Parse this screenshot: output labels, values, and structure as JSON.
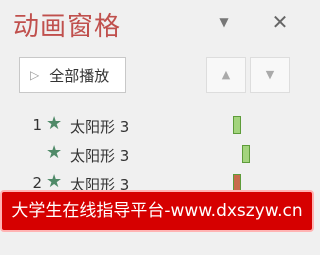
{
  "pane": {
    "title": "动画窗格",
    "menu_icon": "chevron-down-icon",
    "close_icon": "close-icon"
  },
  "toolbar": {
    "play_all_label": "全部播放",
    "move_up_icon": "triangle-up-icon",
    "move_down_icon": "triangle-down-icon"
  },
  "animations": [
    {
      "number": "1",
      "name": "太阳形 3",
      "timing_color": "#a3d47d"
    },
    {
      "number": "",
      "name": "太阳形 3",
      "timing_color": "#a3d47d"
    },
    {
      "number": "2",
      "name": "太阳形 3",
      "timing_color": "#c86b4b"
    }
  ],
  "watermark": {
    "text": "大学生在线指导平台-www.dxszyw.cn"
  }
}
